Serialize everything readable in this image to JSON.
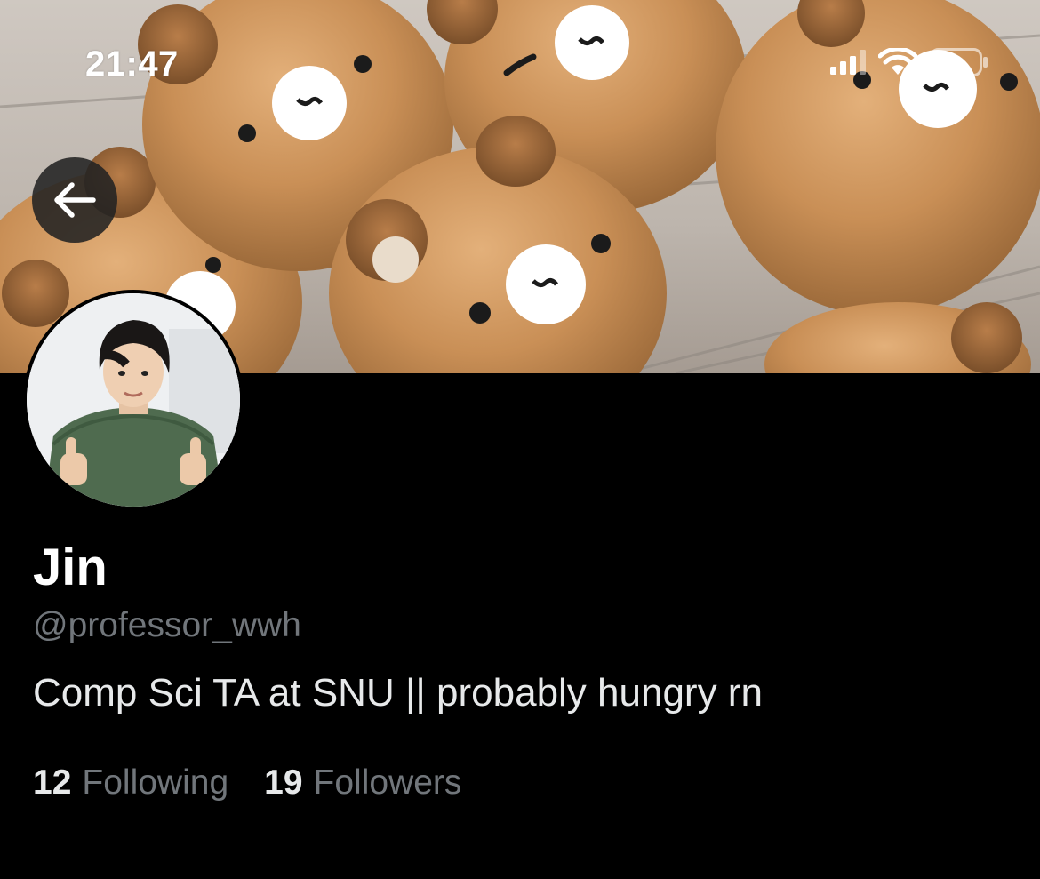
{
  "status_bar": {
    "time": "21:47",
    "signal_icon": "cellular-signal-icon",
    "wifi_icon": "wifi-icon",
    "battery_icon": "battery-icon"
  },
  "header": {
    "back_icon": "arrow-left-icon",
    "banner_image": "bear-shaped bread rolls photo"
  },
  "profile": {
    "avatar_image": "profile photo of man in green sweater giving thumbs up",
    "display_name": "Jin",
    "handle": "@professor_wwh",
    "bio": "Comp Sci TA at SNU || probably hungry rn",
    "following_count": "12",
    "following_label": "Following",
    "followers_count": "19",
    "followers_label": "Followers"
  },
  "colors": {
    "background": "#000000",
    "primary_text": "#e7e9ea",
    "secondary_text": "#71767b"
  }
}
